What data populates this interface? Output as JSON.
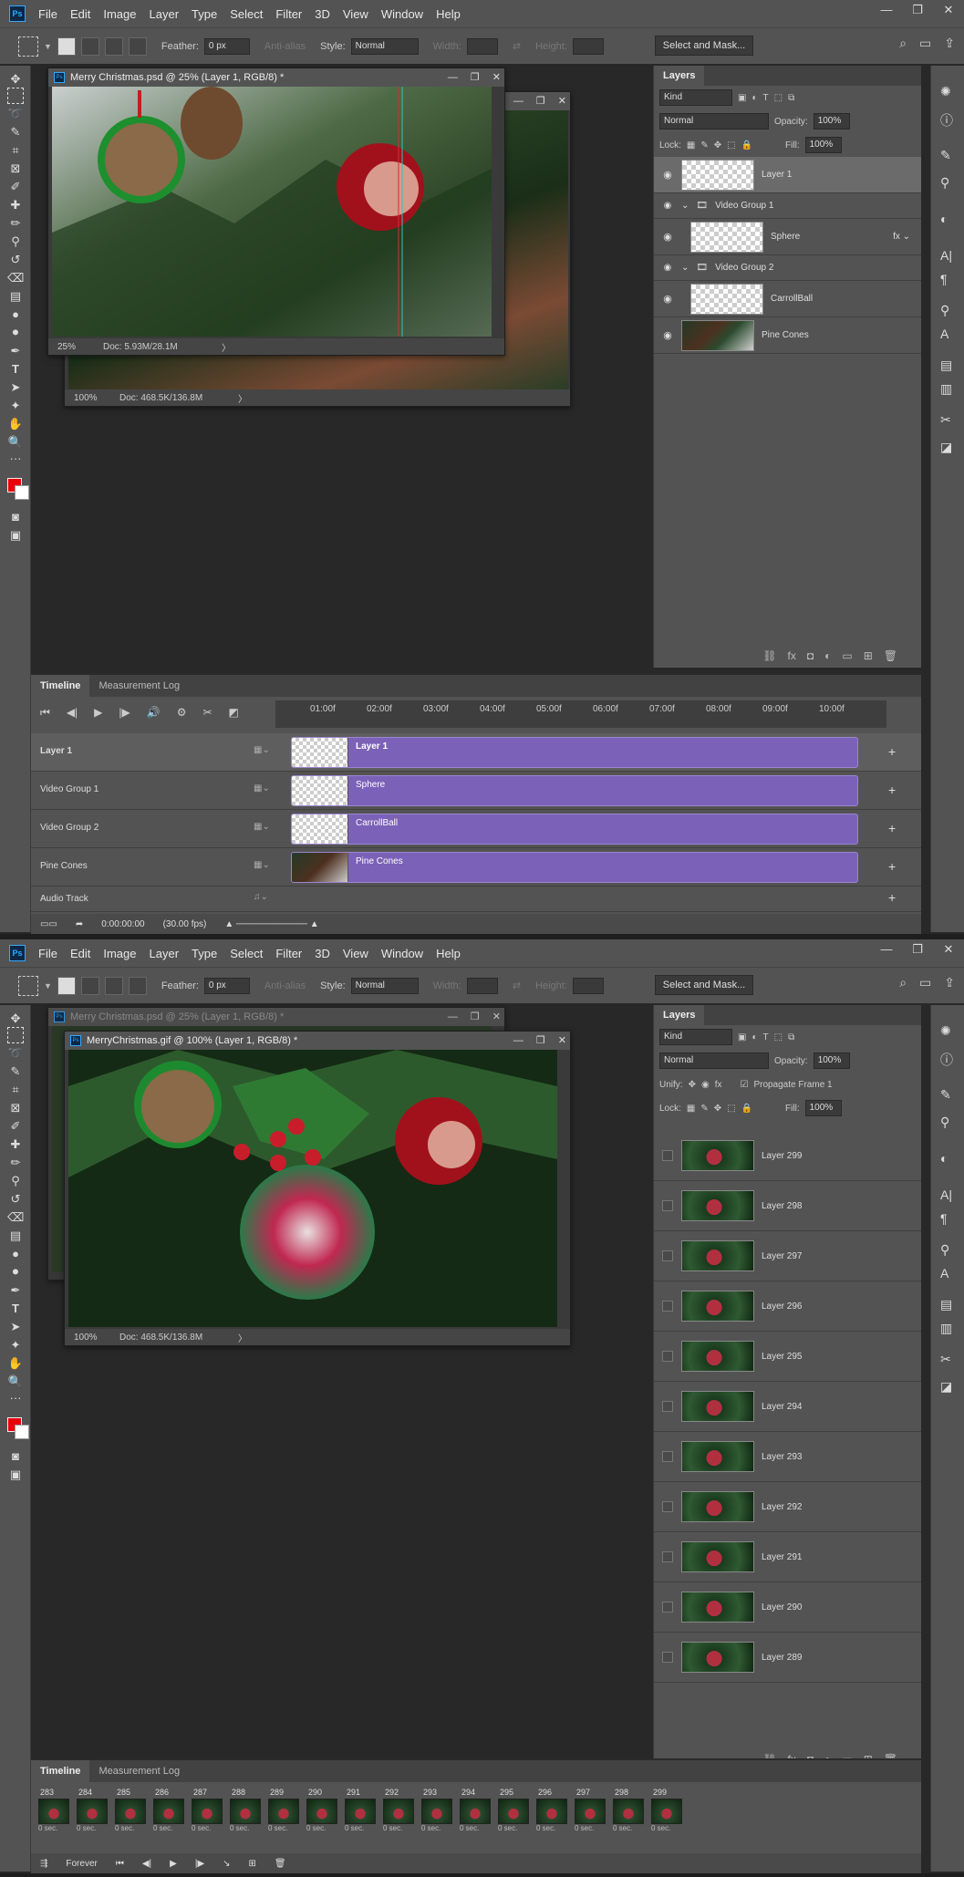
{
  "app": {
    "menu": [
      "File",
      "Edit",
      "Image",
      "Layer",
      "Type",
      "Select",
      "Filter",
      "3D",
      "View",
      "Window",
      "Help"
    ],
    "options": {
      "feather_label": "Feather:",
      "feather_value": "0 px",
      "antialias_label": "Anti-alias",
      "style_label": "Style:",
      "style_value": "Normal",
      "width_label": "Width:",
      "height_label": "Height:",
      "select_mask": "Select and Mask..."
    }
  },
  "top": {
    "doc_front": {
      "title": "Merry Christmas.psd @ 25% (Layer 1, RGB/8) *",
      "zoom": "25%",
      "doc": "Doc: 5.93M/28.1M"
    },
    "doc_back": {
      "zoom": "100%",
      "doc": "Doc: 468.5K/136.8M"
    },
    "layers": {
      "tab": "Layers",
      "kind": "Kind",
      "blend": "Normal",
      "opacity_label": "Opacity:",
      "opacity": "100%",
      "lock_label": "Lock:",
      "fill_label": "Fill:",
      "fill": "100%",
      "items": [
        {
          "name": "Layer 1"
        },
        {
          "group": "Video Group 1"
        },
        {
          "name": "Sphere"
        },
        {
          "group": "Video Group 2"
        },
        {
          "name": "CarrollBall"
        },
        {
          "name": "Pine Cones"
        }
      ]
    },
    "timeline": {
      "tabs": [
        "Timeline",
        "Measurement Log"
      ],
      "ruler": [
        "01:00f",
        "02:00f",
        "03:00f",
        "04:00f",
        "05:00f",
        "06:00f",
        "07:00f",
        "08:00f",
        "09:00f",
        "10:00f"
      ],
      "tracks": [
        {
          "name": "Layer 1",
          "clip": "Layer 1"
        },
        {
          "name": "Video Group 1",
          "clip": "Sphere"
        },
        {
          "name": "Video Group 2",
          "clip": "CarrollBall"
        },
        {
          "name": "Pine Cones",
          "clip": "Pine Cones"
        }
      ],
      "audio": "Audio Track",
      "timecode": "0:00:00:00",
      "fps": "(30.00 fps)"
    }
  },
  "bottom": {
    "doc_back": {
      "title": "Merry Christmas.psd @ 25% (Layer 1, RGB/8) *"
    },
    "doc_front": {
      "title": "MerryChristmas.gif @ 100% (Layer 1, RGB/8) *",
      "zoom": "100%",
      "doc": "Doc: 468.5K/136.8M"
    },
    "layers": {
      "tab": "Layers",
      "kind": "Kind",
      "blend": "Normal",
      "opacity_label": "Opacity:",
      "opacity": "100%",
      "unify_label": "Unify:",
      "propagate": "Propagate Frame 1",
      "lock_label": "Lock:",
      "fill_label": "Fill:",
      "fill": "100%",
      "items": [
        "Layer 299",
        "Layer 298",
        "Layer 297",
        "Layer 296",
        "Layer 295",
        "Layer 294",
        "Layer 293",
        "Layer 292",
        "Layer 291",
        "Layer 290",
        "Layer 289"
      ]
    },
    "timeline": {
      "tabs": [
        "Timeline",
        "Measurement Log"
      ],
      "frames": [
        "283",
        "284",
        "285",
        "286",
        "287",
        "288",
        "289",
        "290",
        "291",
        "292",
        "293",
        "294",
        "295",
        "296",
        "297",
        "298",
        "299"
      ],
      "frame_delay": "0 sec.",
      "loop": "Forever"
    }
  },
  "colors": {
    "foreground": "#e8000b",
    "background": "#ffffff",
    "clip": "#7b61b7",
    "accent": "#31a8ff"
  }
}
